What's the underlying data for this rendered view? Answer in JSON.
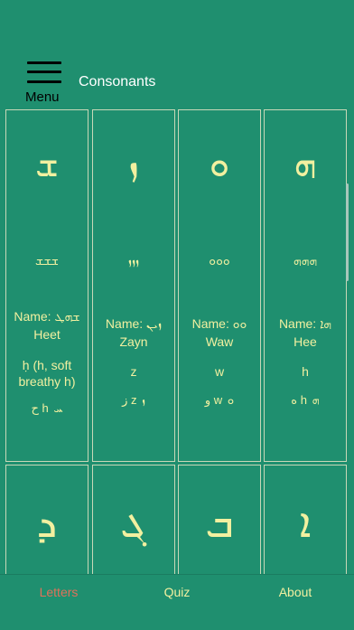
{
  "header": {
    "menu_label": "Menu",
    "title": "Consonants"
  },
  "letters": [
    {
      "glyph": "ܫ",
      "word": "ܫܫܫ",
      "name": "Name: ܫܗܛ",
      "name_latin": "Heet",
      "sound": "ḥ (h, soft breathy h)",
      "translit": "ح h ܚ"
    },
    {
      "glyph": "ܙ",
      "word": "ܙܙܙ",
      "name": "Name: ܙܝܢ",
      "name_latin": "Zayn",
      "sound": "z",
      "translit": "ز z ܙ"
    },
    {
      "glyph": "ܘ",
      "word": "ܘܘܘ",
      "name": "Name: ܘܘ",
      "name_latin": "Waw",
      "sound": "w",
      "translit": "و w ܘ"
    },
    {
      "glyph": "ܗ",
      "word": "ܗܗܗ",
      "name": "Name: ܗܐ",
      "name_latin": "Hee",
      "sound": "h",
      "translit": "ه h ܗ"
    }
  ],
  "letters_row2": [
    {
      "glyph": "ܕ"
    },
    {
      "glyph": "ܓ"
    },
    {
      "glyph": "ܒ"
    },
    {
      "glyph": "ܐ"
    }
  ],
  "tabs": {
    "letters": "Letters",
    "quiz": "Quiz",
    "about": "About"
  },
  "colors": {
    "background": "#1f8f6f",
    "text": "#f2f0a0",
    "active_tab": "#e0715a"
  }
}
